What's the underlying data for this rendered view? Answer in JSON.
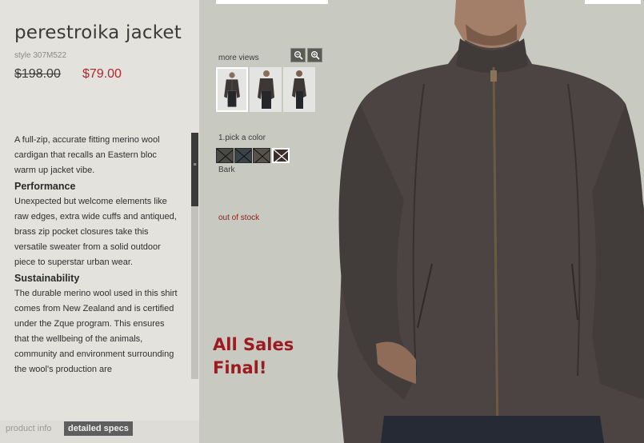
{
  "product": {
    "title": "perestroika jacket",
    "style": "style 307M522",
    "old_price": "$198.00",
    "new_price": "$79.00"
  },
  "description": {
    "intro": "A full-zip, accurate fitting merino wool cardigan that recalls an Eastern bloc warm up jacket vibe.",
    "sections": [
      {
        "heading": "Performance",
        "text": "Unexpected but welcome elements like raw edges, extra wide cuffs and antiqued, brass zip pocket closures take this versatile sweater from a solid outdoor piece to superstar urban wear."
      },
      {
        "heading": "Sustainability",
        "text": "The durable merino wool used in this shirt comes from New Zealand and is certified under the Zque program. This ensures that the wellbeing of the animals, community and environment surrounding the wool's production are"
      }
    ]
  },
  "tabs": {
    "product_info": "product info",
    "detailed_specs": "detailed specs"
  },
  "views": {
    "label": "more views",
    "zoom_out_icon": "zoom-out-icon",
    "zoom_in_icon": "zoom-in-icon",
    "thumbnails": [
      "front view",
      "angled view",
      "side view"
    ]
  },
  "color": {
    "label": "1.pick a color",
    "selected": "Bark",
    "swatches": [
      "#4a4a47",
      "#3a4347",
      "#56524a",
      "#3b2f2b"
    ]
  },
  "stock": "out of stock",
  "sale_notice": "All Sales Final!",
  "colors": {
    "price_red": "#b3262c",
    "sale_red": "#9c1b20",
    "background": "#c8c9c0",
    "panel": "#e3e2dc"
  }
}
